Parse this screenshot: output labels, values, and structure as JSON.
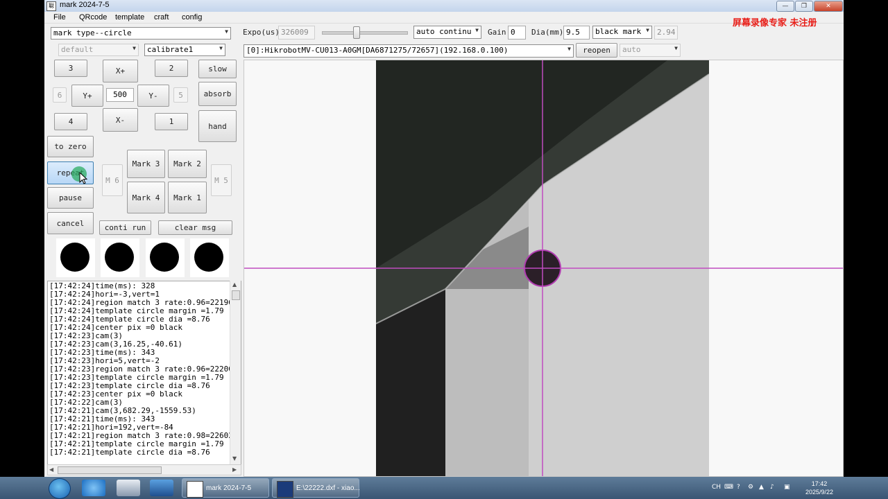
{
  "window": {
    "title": "mark 2024-7-5",
    "icon_glyph": "聪",
    "minimize": "—",
    "maximize": "❐",
    "close": "✕"
  },
  "menu": [
    "File",
    "QRcode",
    "template",
    "craft",
    "config"
  ],
  "watermark": "屏幕录像专家  未注册",
  "left_panel": {
    "mark_type": "mark type--circle",
    "profile": "default",
    "calibrate": "calibrate1",
    "jog": {
      "b3": "3",
      "b2": "2",
      "b4": "4",
      "b1": "1",
      "xplus": "X+",
      "xminus": "X-",
      "yplus": "Y+",
      "yminus": "Y-",
      "b6": "6",
      "b5": "5",
      "step": "500",
      "slow": "slow",
      "absorb": "absorb",
      "hand": "hand"
    },
    "to_zero": "to zero",
    "repeat": "repeat",
    "pause": "pause",
    "cancel": "cancel",
    "m6": "M 6",
    "m5": "M 5",
    "mark3": "Mark 3",
    "mark2": "Mark 2",
    "mark4": "Mark 4",
    "mark1": "Mark 1",
    "conti_run": "conti run",
    "clear_msg": "clear msg",
    "log": [
      "[17:42:24]time(ms): 328",
      "[17:42:24]hori=-3,vert=1",
      "[17:42:24]region match 3 rate:0.96=22196/",
      "[17:42:24]template circle margin =1.79",
      "[17:42:24]template circle dia =8.76",
      "[17:42:24]center pix =0 black",
      "[17:42:23]cam(3)",
      "[17:42:23]cam(3,16.25,-40.61)",
      "[17:42:23]time(ms): 343",
      "[17:42:23]hori=5,vert=-2",
      "[17:42:23]region match 3 rate:0.96=22200/",
      "[17:42:23]template circle margin =1.79",
      "[17:42:23]template circle dia =8.76",
      "[17:42:23]center pix =0 black",
      "[17:42:22]cam(3)",
      "[17:42:21]cam(3,682.29,-1559.53)",
      "[17:42:21]time(ms): 343",
      "[17:42:21]hori=192,vert=-84",
      "[17:42:21]region match 3 rate:0.98=22602/",
      "[17:42:21]template circle margin =1.79",
      "[17:42:21]template circle dia =8.76"
    ]
  },
  "camera_bar": {
    "expo_label": "Expo(us)",
    "expo_value": "326009",
    "mode": "auto continu",
    "gain_label": "Gain",
    "gain_value": "0",
    "dia_label": "Dia(mm)",
    "dia_value": "9.5",
    "mark_color": "black mark",
    "ratio": "2.94",
    "device": "[0]:HikrobotMV-CU013-A0GM[DA6871275/72657](192.168.0.100)",
    "reopen": "reopen",
    "auto_mode": "auto"
  },
  "crosshair_color": "#c04cc0",
  "taskbar": {
    "task1": "mark 2024-7-5",
    "task2": "E:\\22222.dxf - xiao...",
    "lang": "CH",
    "time": "17:42",
    "date": "2025/9/22"
  }
}
